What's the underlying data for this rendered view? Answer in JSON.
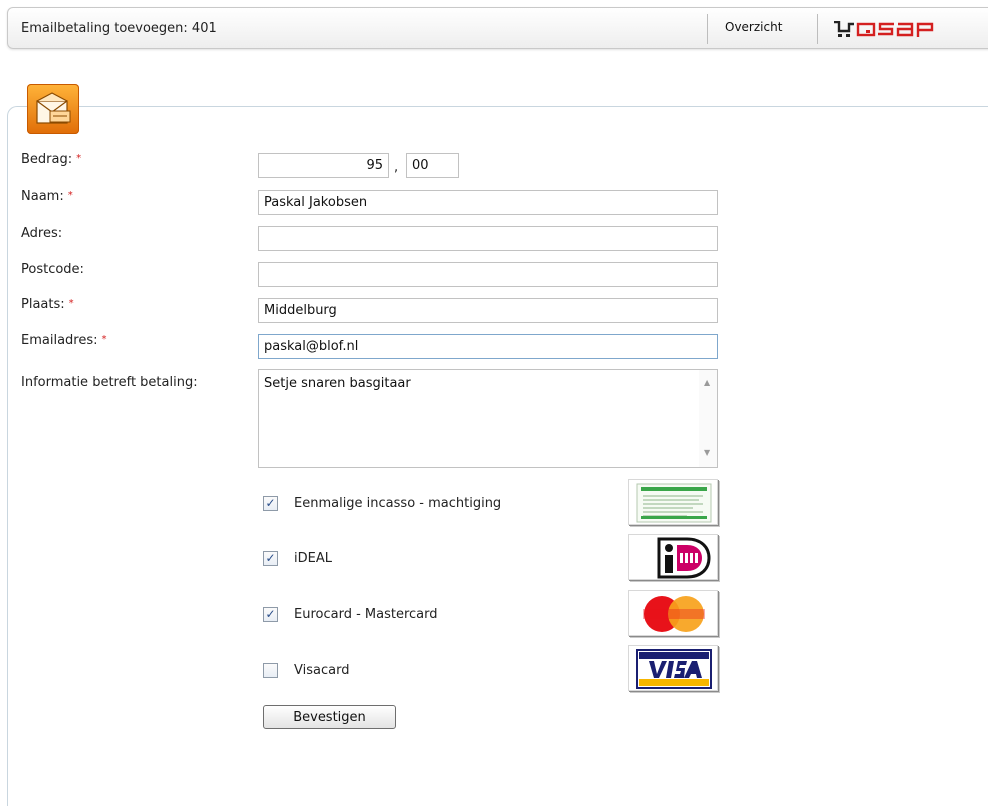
{
  "header": {
    "title": "Emailbetaling toevoegen: 401",
    "nav_link": "Overzicht",
    "logo_text": "QSAP"
  },
  "form": {
    "required_mark": "*",
    "amount": {
      "label": "Bedrag:",
      "euros": "95",
      "comma": ",",
      "cents": "00"
    },
    "name": {
      "label": "Naam:",
      "value": "Paskal Jakobsen"
    },
    "address": {
      "label": "Adres:",
      "value": ""
    },
    "postcode": {
      "label": "Postcode:",
      "value": ""
    },
    "city": {
      "label": "Plaats:",
      "value": "Middelburg"
    },
    "email": {
      "label": "Emailadres:",
      "value": "paskal@blof.nl"
    },
    "info": {
      "label": "Informatie betreft betaling:",
      "value": "Setje snaren basgitaar"
    }
  },
  "payment_methods": [
    {
      "label": "Eenmalige incasso - machtiging",
      "checked": true,
      "icon": "incasso-form-icon"
    },
    {
      "label": "iDEAL",
      "checked": true,
      "icon": "ideal-logo"
    },
    {
      "label": "Eurocard - Mastercard",
      "checked": true,
      "icon": "mastercard-logo"
    },
    {
      "label": "Visacard",
      "checked": false,
      "icon": "visa-logo"
    }
  ],
  "submit_label": "Bevestigen",
  "colors": {
    "accent_orange": "#f08a14",
    "logo_red": "#d42020",
    "required": "#d42020"
  }
}
